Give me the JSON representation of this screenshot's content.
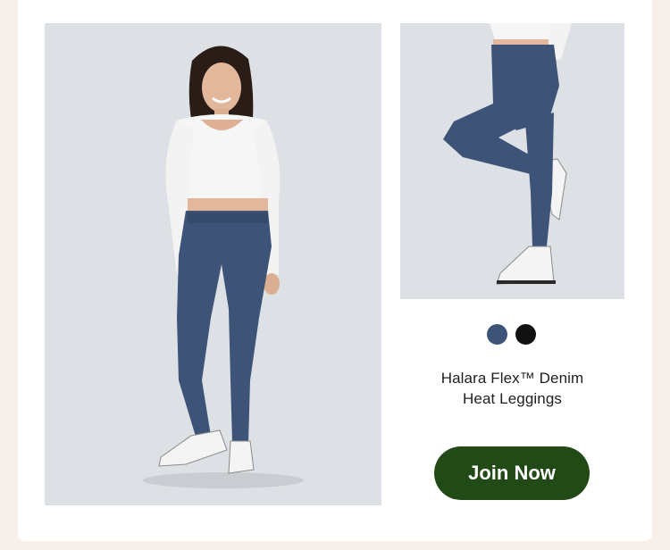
{
  "product": {
    "name_line1": "Halara Flex™ Denim",
    "name_line2": "Heat Leggings",
    "main_image_alt": "Model wearing white long-sleeve crop top and blue denim leggings",
    "side_image_alt": "Side view of blue denim leggings with white sneakers"
  },
  "swatches": [
    {
      "name": "denim-blue",
      "color": "#3d5478"
    },
    {
      "name": "black",
      "color": "#111111"
    }
  ],
  "cta": {
    "label": "Join Now",
    "color": "#224a17"
  },
  "colors": {
    "page_bg": "#f7efe9",
    "card_bg": "#ffffff",
    "photo_bg": "#dde0e4"
  }
}
